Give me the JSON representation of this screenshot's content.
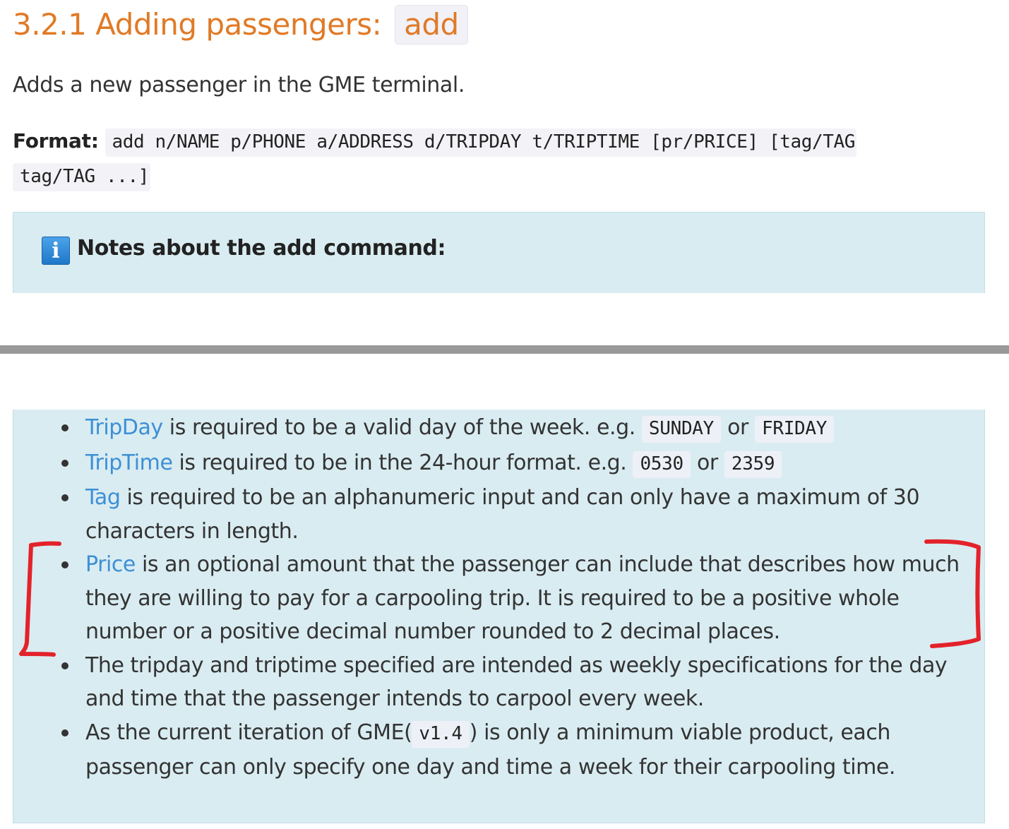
{
  "section": {
    "heading_text": "3.2.1 Adding passengers:",
    "heading_code": "add",
    "intro": "Adds a new passenger in the GME terminal.",
    "format_label": "Format:",
    "format_code": "add n/NAME p/PHONE a/ADDRESS d/TRIPDAY t/TRIPTIME [pr/PRICE] [tag/TAG tag/TAG ...]"
  },
  "note": {
    "icon": "info-icon",
    "title": "Notes about the add command:",
    "items": [
      {
        "term": "TripDay",
        "text1": " is required to be a valid day of the week. e.g. ",
        "code1": "SUNDAY",
        "text2": " or ",
        "code2": "FRIDAY"
      },
      {
        "term": "TripTime",
        "text1": " is required to be in the 24-hour format. e.g. ",
        "code1": "0530",
        "text2": " or ",
        "code2": "2359"
      },
      {
        "term": "Tag",
        "text1": " is required to be an alphanumeric input and can only have a maximum of 30 characters in length."
      },
      {
        "term": "Price",
        "text1": " is an optional amount that the passenger can include that describes how much they are willing to pay for a carpooling trip. It is required to be a positive whole number or a positive decimal number rounded to 2 decimal places."
      },
      {
        "text1": "The tripday and triptime specified are intended as weekly specifications for the day and time that the passenger intends to carpool every week."
      },
      {
        "text1": "As the current iteration of GME(",
        "code1": "v1.4",
        "text2": ") is only a minimum viable product, each passenger can only specify one day and time a week for their carpooling time."
      }
    ]
  },
  "annotation_color": "#e3222b",
  "link_color": "#3d8fd6",
  "heading_color": "#e07a26",
  "note_background": "#d9ecf1"
}
